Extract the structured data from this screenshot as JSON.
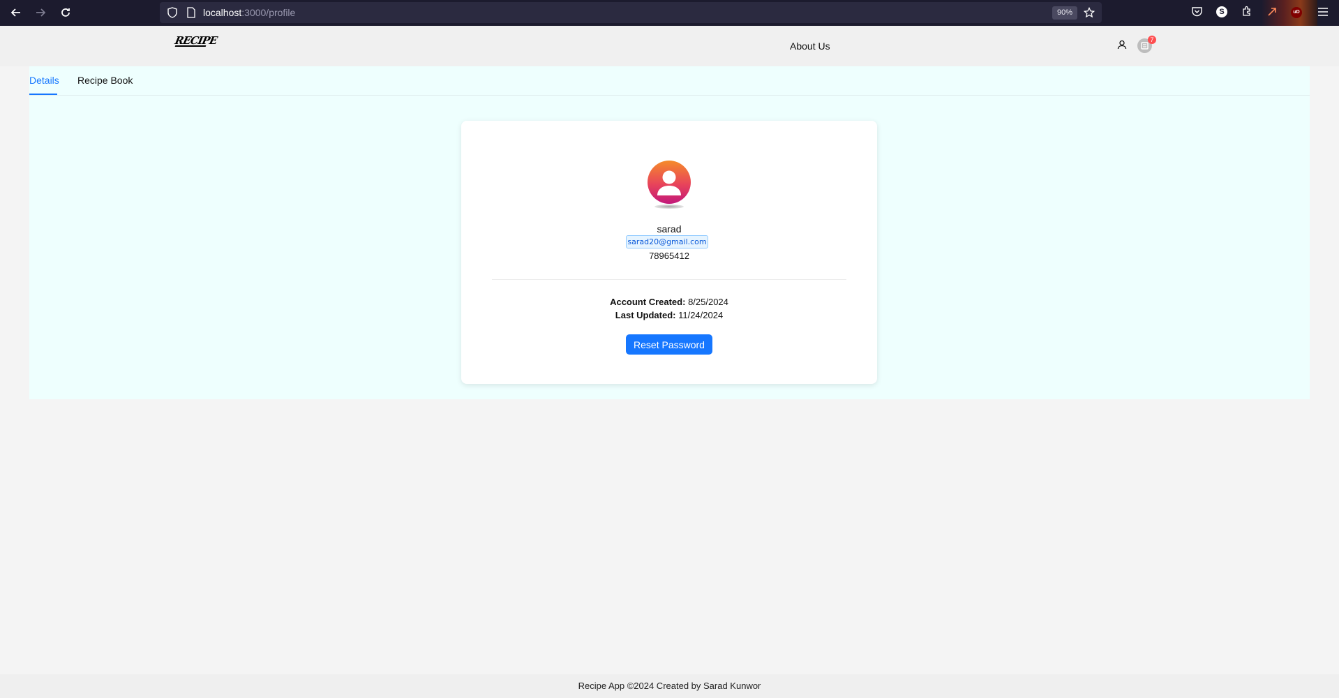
{
  "browser": {
    "url_host": "localhost",
    "url_path": ":3000/profile",
    "zoom": "90%"
  },
  "header": {
    "logo_text": "RECIPE",
    "about_link": "About Us",
    "cart_count": "7"
  },
  "tabs": [
    {
      "label": "Details",
      "active": true
    },
    {
      "label": "Recipe Book",
      "active": false
    }
  ],
  "profile": {
    "username": "sarad",
    "email": "sarad20@gmail.com",
    "phone": "78965412",
    "account_created_label": "Account Created:",
    "account_created_value": "8/25/2024",
    "last_updated_label": "Last Updated:",
    "last_updated_value": "11/24/2024",
    "reset_button": "Reset Password"
  },
  "footer": {
    "text": "Recipe App ©2024 Created by Sarad Kunwor"
  },
  "colors": {
    "accent": "#1677ff",
    "tab_bg": "#eefffe",
    "badge": "#ff4d4f"
  }
}
